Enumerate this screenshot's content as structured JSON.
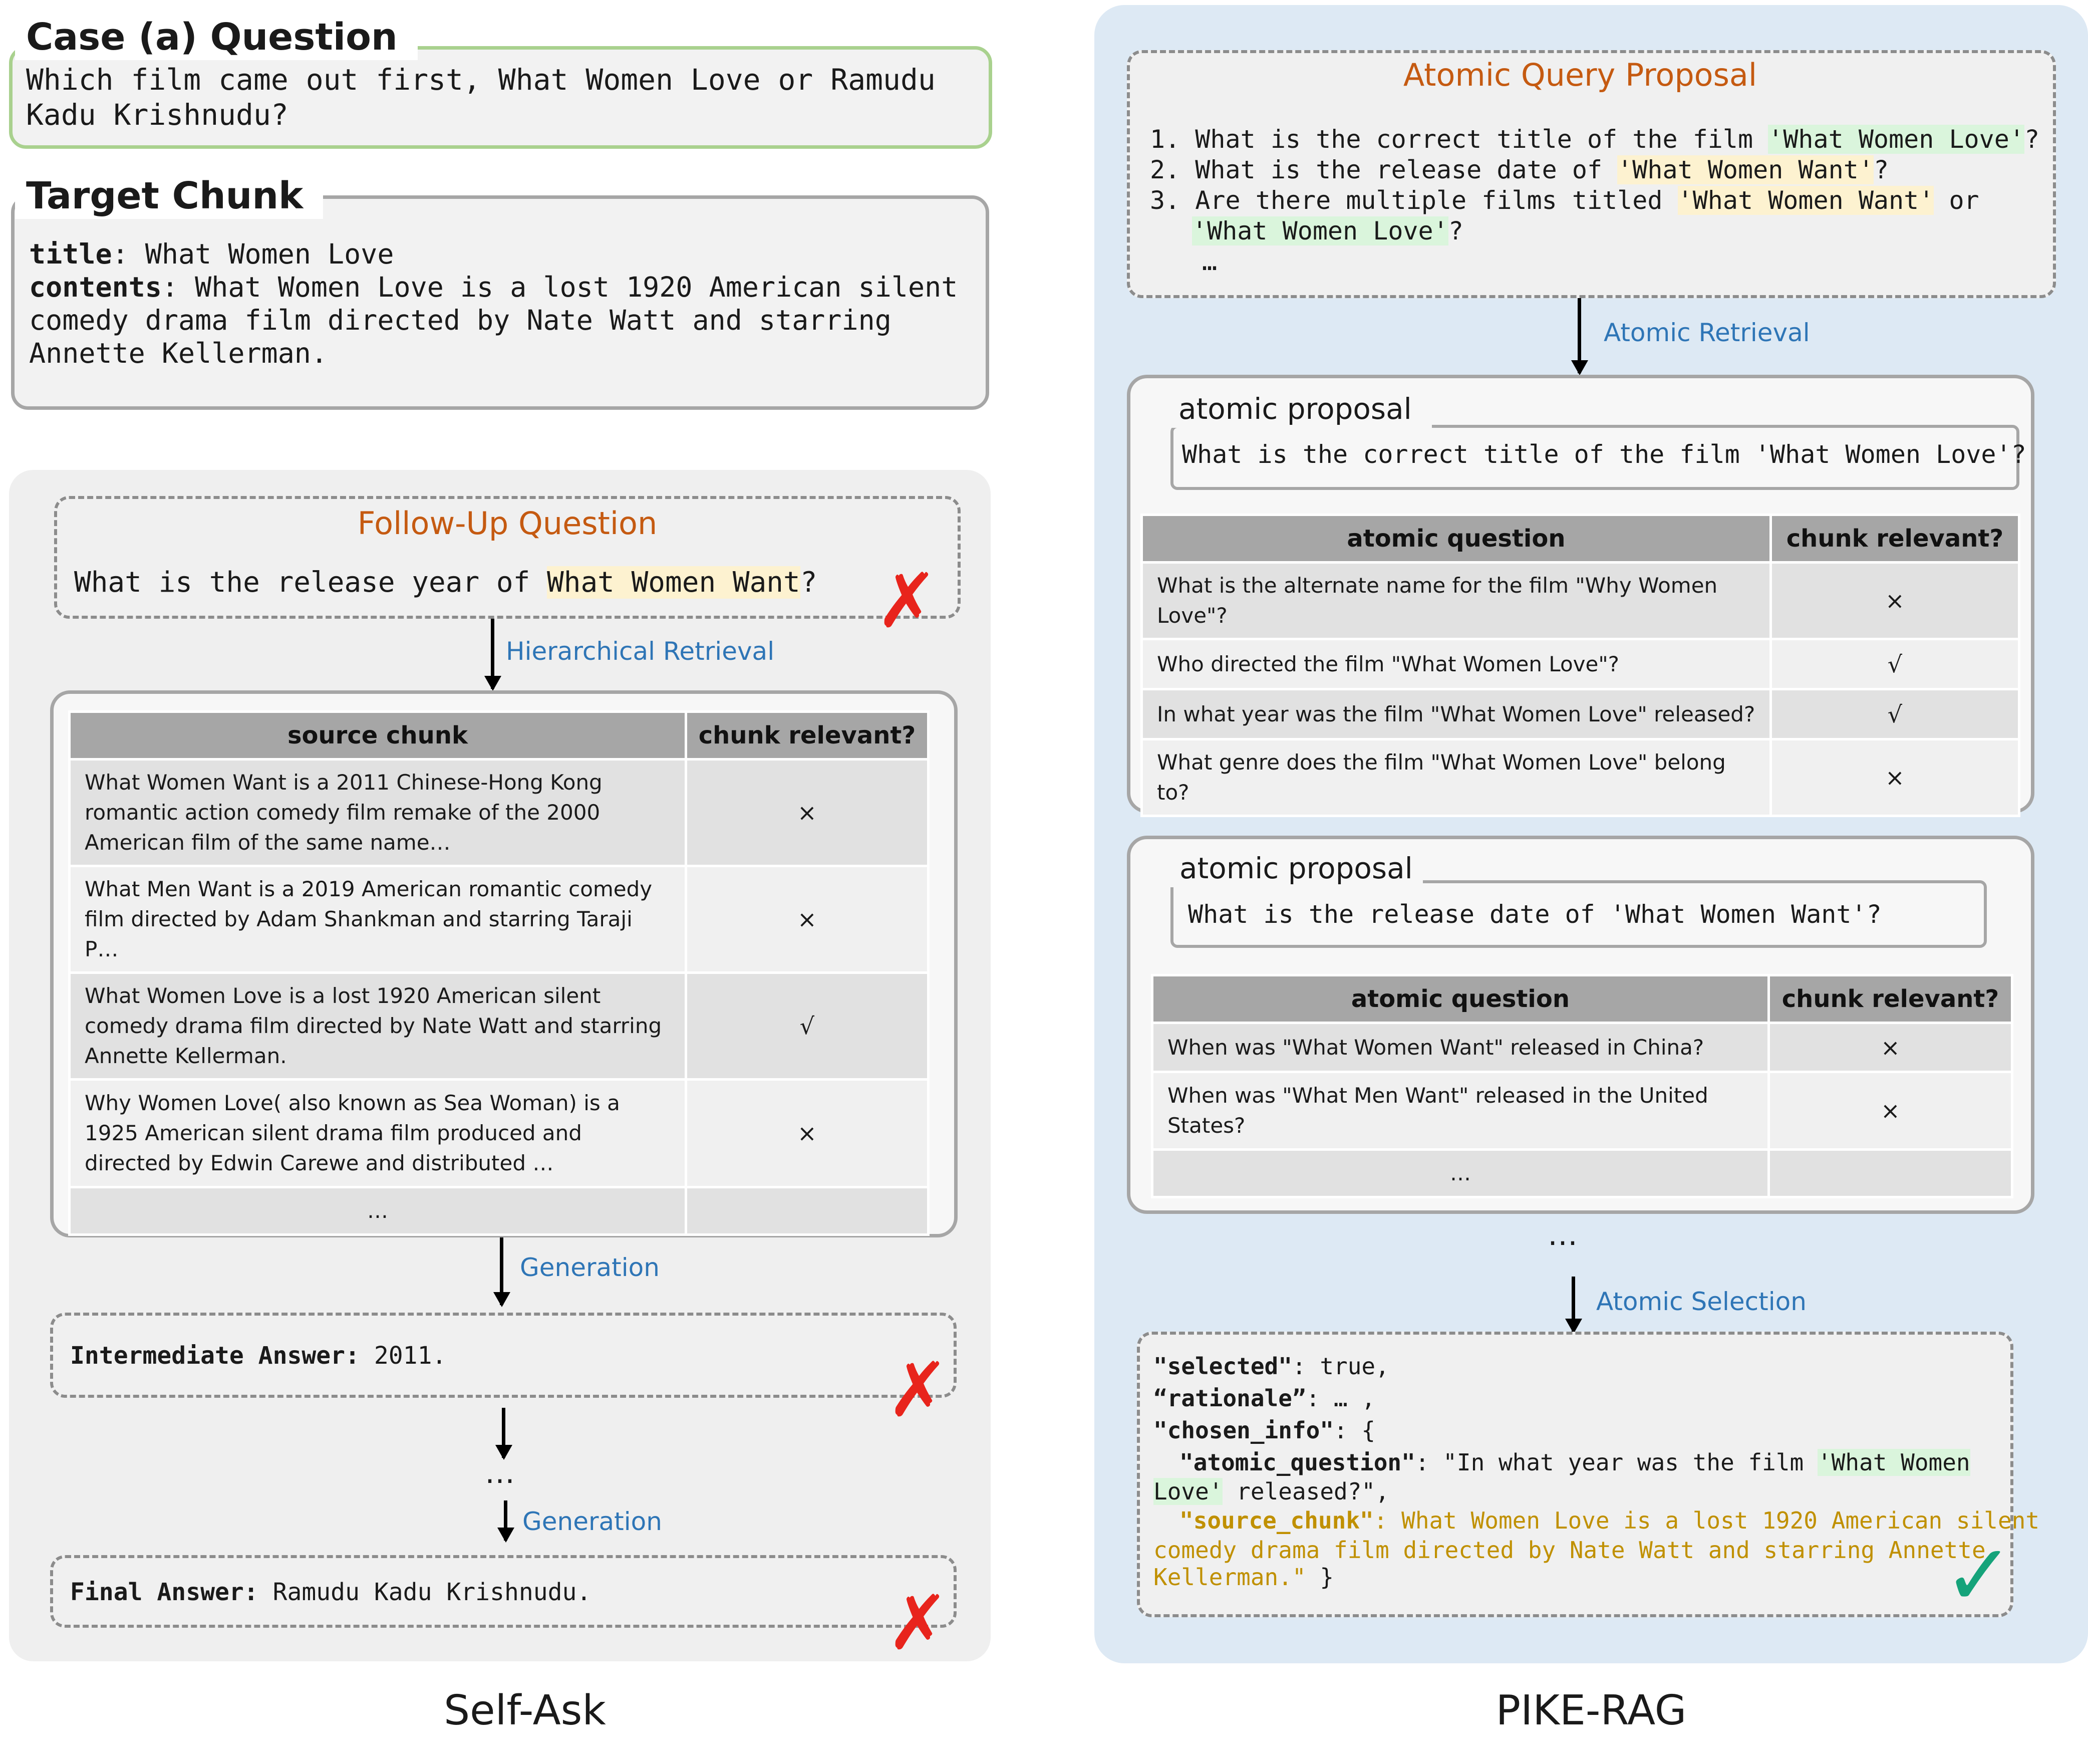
{
  "case": {
    "title": "Case (a) Question",
    "question": "Which film came out first, What Women Love or Ramudu Kadu Krishnudu?"
  },
  "target": {
    "title": "Target Chunk",
    "title_label": "title",
    "title_value": ": What Women Love",
    "contents_label": "contents",
    "contents_value": ": What Women Love is a lost 1920 American silent comedy drama film directed by Nate Watt and starring Annette Kellerman."
  },
  "self_ask": {
    "label": "Self-Ask",
    "followup_title": "Follow-Up Question",
    "followup_prefix": "What is the release year of ",
    "followup_highlight": "What Women Want",
    "followup_suffix": "?",
    "hier_retrieval": "Hierarchical Retrieval",
    "table_headers": [
      "source chunk",
      "chunk relevant?"
    ],
    "rows": [
      {
        "text": "What Women Want is a 2011 Chinese-Hong Kong romantic action comedy film remake of the 2000 American film of the same name…",
        "mark": "×"
      },
      {
        "text": "What Men Want is a 2019 American romantic comedy film directed by Adam Shankman and starring Taraji P…",
        "mark": "×"
      },
      {
        "text": "What Women Love is a lost 1920 American silent comedy drama film directed by Nate Watt and starring Annette Kellerman.",
        "mark": "√"
      },
      {
        "text": "Why Women Love( also known as Sea Woman) is a 1925 American silent drama film produced and directed by Edwin Carewe and distributed …",
        "mark": "×"
      },
      {
        "text": "…",
        "mark": ""
      }
    ],
    "generation1": "Generation",
    "intermediate_label": "Intermediate Answer:",
    "intermediate_value": " 2011.",
    "ellipsis": "…",
    "generation2": "Generation",
    "final_label": "Final Answer:",
    "final_value": " Ramudu Kadu Krishnudu.",
    "x_mark": "✗"
  },
  "pike": {
    "label": "PIKE-RAG",
    "proposal_title": "Atomic Query Proposal",
    "q1_prefix": "1. What is the correct title of the film ",
    "q1_hl": "'What Women Love'",
    "q1_suffix": "?",
    "q2_prefix": "2. What is the release date of ",
    "q2_hl": "'What Women Want'",
    "q2_suffix": "?",
    "q3_prefix": "3. Are there multiple films titled ",
    "q3_hl1": "'What Women Want'",
    "q3_mid": " or",
    "q3_hl2": "'What Women Love'",
    "q3_suffix": "?",
    "q_more": "…",
    "atomic_retrieval": "Atomic Retrieval",
    "box1": {
      "title": "atomic proposal",
      "proposal": "What is the correct title of the film 'What Women Love'?",
      "headers": [
        "atomic question",
        "chunk relevant?"
      ],
      "rows": [
        {
          "text": "What is the alternate name for the film \"Why Women Love\"?",
          "mark": "×"
        },
        {
          "text": "Who directed the film \"What Women Love\"?",
          "mark": "√"
        },
        {
          "text": "In what year was the film \"What Women Love\" released?",
          "mark": "√"
        },
        {
          "text": "What genre does the film \"What Women Love\" belong to?",
          "mark": "×"
        }
      ]
    },
    "box2": {
      "title": "atomic proposal",
      "proposal": "What is the release date of 'What Women Want'?",
      "headers": [
        "atomic question",
        "chunk relevant?"
      ],
      "rows": [
        {
          "text": "When was \"What Women Want\" released in China?",
          "mark": "×"
        },
        {
          "text": "When was \"What Men Want\" released in the United States?",
          "mark": "×"
        },
        {
          "text": "…",
          "mark": ""
        }
      ]
    },
    "between_ellipsis": "…",
    "atomic_selection": "Atomic Selection",
    "json": {
      "selected_key": "\"selected\"",
      "selected_val": ": true,",
      "rationale_key": "“rationale”",
      "rationale_val": ": … ,",
      "chosen_key": "\"chosen_info\"",
      "chosen_val": ": {",
      "aq_key": "\"atomic_question\"",
      "aq_val_a": ": \"In what year was the film ",
      "aq_hl_a": "'What Women ",
      "aq_hl_b": "Love'",
      "aq_val_b": " released?\",",
      "sc_key": "\"source_chunk\"",
      "sc_val_1": ": What Women Love is a lost 1920 American silent",
      "sc_val_2": "comedy drama film directed by Nate Watt and starring Annette",
      "sc_val_3": "Kellerman.\"",
      "sc_close": " }"
    },
    "check_mark": "✓"
  },
  "colors": {
    "orange": "#c55a11",
    "blue": "#2e75b6",
    "green_border": "#a9d18e",
    "red_x": "#e8241c",
    "green_check": "#15a37a"
  }
}
